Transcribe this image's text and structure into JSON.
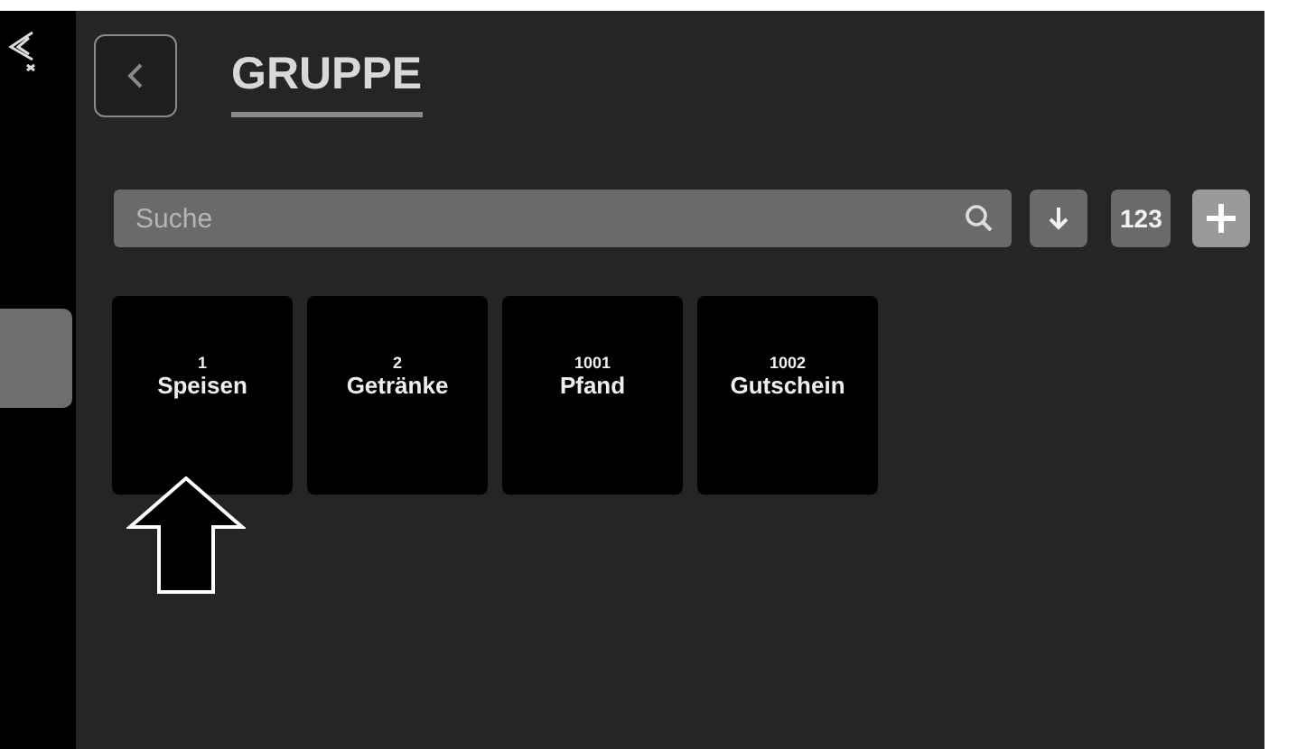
{
  "header": {
    "title": "GRUPPE"
  },
  "search": {
    "placeholder": "Suche"
  },
  "toolbar": {
    "numeric_button": "123"
  },
  "groups": [
    {
      "number": "1",
      "name": "Speisen"
    },
    {
      "number": "2",
      "name": "Getränke"
    },
    {
      "number": "1001",
      "name": "Pfand"
    },
    {
      "number": "1002",
      "name": "Gutschein"
    }
  ]
}
